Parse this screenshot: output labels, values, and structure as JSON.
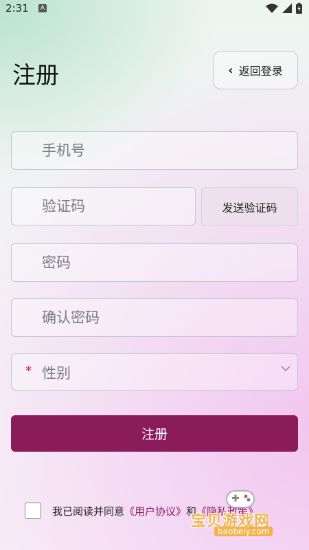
{
  "status_bar": {
    "time": "2:31",
    "notification_icon": "A"
  },
  "header": {
    "title": "注册",
    "back_button_label": "返回登录"
  },
  "form": {
    "phone_placeholder": "手机号",
    "code_placeholder": "验证码",
    "send_code_label": "发送验证码",
    "password_placeholder": "密码",
    "confirm_password_placeholder": "确认密码",
    "gender_required_mark": "*",
    "gender_placeholder": "性别",
    "submit_label": "注册"
  },
  "agreement": {
    "prefix": "我已阅读并同意",
    "user_agreement": "《用户协议》",
    "conjunction": "和",
    "privacy_link": "《隐私政策》",
    "checked": false
  },
  "watermark": {
    "title": "宝贝游戏网",
    "domain": "baobeiy.com"
  },
  "colors": {
    "accent": "#8a1c5c",
    "required": "#d32f2f"
  }
}
